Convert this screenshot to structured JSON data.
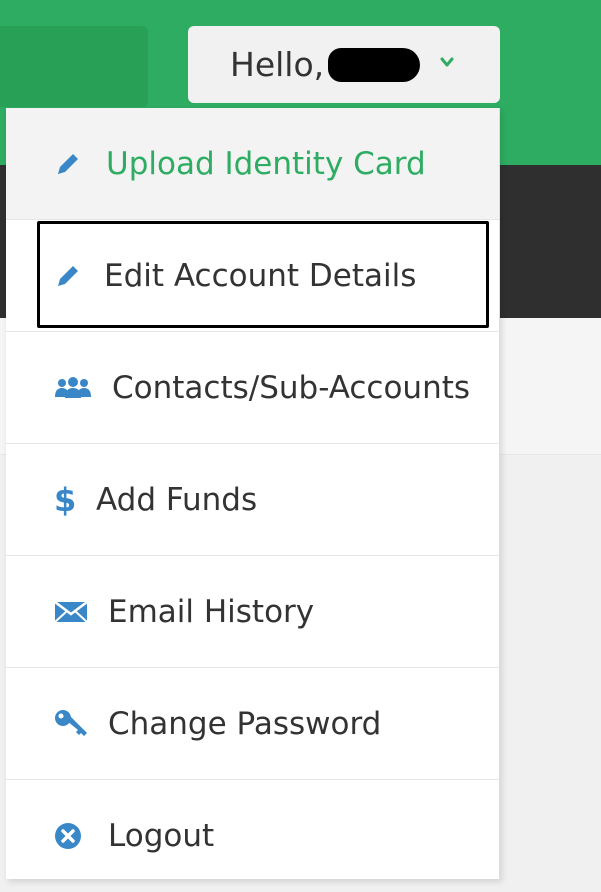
{
  "header": {
    "greeting": "Hello,"
  },
  "menu": {
    "items": [
      {
        "label": "Upload Identity Card",
        "icon": "pencil-icon"
      },
      {
        "label": "Edit Account Details",
        "icon": "pencil-icon"
      },
      {
        "label": "Contacts/Sub-Accounts",
        "icon": "users-icon"
      },
      {
        "label": "Add Funds",
        "icon": "dollar-icon"
      },
      {
        "label": "Email History",
        "icon": "envelope-icon"
      },
      {
        "label": "Change Password",
        "icon": "key-icon"
      },
      {
        "label": "Logout",
        "icon": "close-circle-icon"
      }
    ]
  },
  "colors": {
    "brand_green": "#2eac61",
    "icon_blue": "#3a87c8",
    "dark_bar": "#2f2f2f"
  }
}
